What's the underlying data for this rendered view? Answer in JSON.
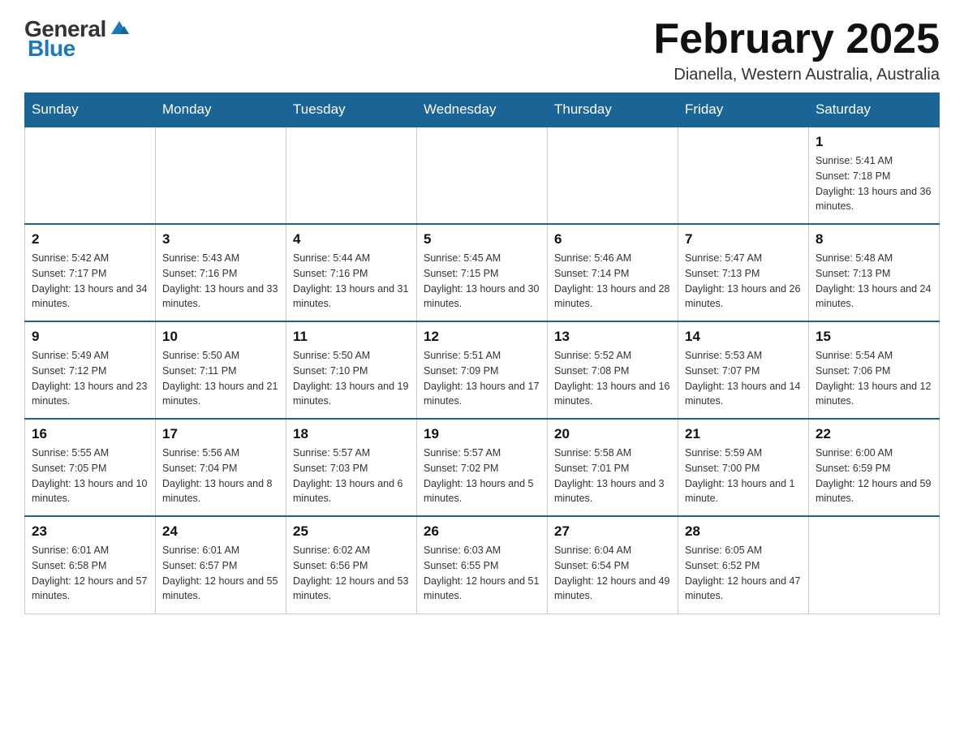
{
  "header": {
    "logo_general": "General",
    "logo_blue": "Blue",
    "title": "February 2025",
    "subtitle": "Dianella, Western Australia, Australia"
  },
  "days_of_week": [
    "Sunday",
    "Monday",
    "Tuesday",
    "Wednesday",
    "Thursday",
    "Friday",
    "Saturday"
  ],
  "weeks": [
    [
      {
        "day": "",
        "sunrise": "",
        "sunset": "",
        "daylight": ""
      },
      {
        "day": "",
        "sunrise": "",
        "sunset": "",
        "daylight": ""
      },
      {
        "day": "",
        "sunrise": "",
        "sunset": "",
        "daylight": ""
      },
      {
        "day": "",
        "sunrise": "",
        "sunset": "",
        "daylight": ""
      },
      {
        "day": "",
        "sunrise": "",
        "sunset": "",
        "daylight": ""
      },
      {
        "day": "",
        "sunrise": "",
        "sunset": "",
        "daylight": ""
      },
      {
        "day": "1",
        "sunrise": "Sunrise: 5:41 AM",
        "sunset": "Sunset: 7:18 PM",
        "daylight": "Daylight: 13 hours and 36 minutes."
      }
    ],
    [
      {
        "day": "2",
        "sunrise": "Sunrise: 5:42 AM",
        "sunset": "Sunset: 7:17 PM",
        "daylight": "Daylight: 13 hours and 34 minutes."
      },
      {
        "day": "3",
        "sunrise": "Sunrise: 5:43 AM",
        "sunset": "Sunset: 7:16 PM",
        "daylight": "Daylight: 13 hours and 33 minutes."
      },
      {
        "day": "4",
        "sunrise": "Sunrise: 5:44 AM",
        "sunset": "Sunset: 7:16 PM",
        "daylight": "Daylight: 13 hours and 31 minutes."
      },
      {
        "day": "5",
        "sunrise": "Sunrise: 5:45 AM",
        "sunset": "Sunset: 7:15 PM",
        "daylight": "Daylight: 13 hours and 30 minutes."
      },
      {
        "day": "6",
        "sunrise": "Sunrise: 5:46 AM",
        "sunset": "Sunset: 7:14 PM",
        "daylight": "Daylight: 13 hours and 28 minutes."
      },
      {
        "day": "7",
        "sunrise": "Sunrise: 5:47 AM",
        "sunset": "Sunset: 7:13 PM",
        "daylight": "Daylight: 13 hours and 26 minutes."
      },
      {
        "day": "8",
        "sunrise": "Sunrise: 5:48 AM",
        "sunset": "Sunset: 7:13 PM",
        "daylight": "Daylight: 13 hours and 24 minutes."
      }
    ],
    [
      {
        "day": "9",
        "sunrise": "Sunrise: 5:49 AM",
        "sunset": "Sunset: 7:12 PM",
        "daylight": "Daylight: 13 hours and 23 minutes."
      },
      {
        "day": "10",
        "sunrise": "Sunrise: 5:50 AM",
        "sunset": "Sunset: 7:11 PM",
        "daylight": "Daylight: 13 hours and 21 minutes."
      },
      {
        "day": "11",
        "sunrise": "Sunrise: 5:50 AM",
        "sunset": "Sunset: 7:10 PM",
        "daylight": "Daylight: 13 hours and 19 minutes."
      },
      {
        "day": "12",
        "sunrise": "Sunrise: 5:51 AM",
        "sunset": "Sunset: 7:09 PM",
        "daylight": "Daylight: 13 hours and 17 minutes."
      },
      {
        "day": "13",
        "sunrise": "Sunrise: 5:52 AM",
        "sunset": "Sunset: 7:08 PM",
        "daylight": "Daylight: 13 hours and 16 minutes."
      },
      {
        "day": "14",
        "sunrise": "Sunrise: 5:53 AM",
        "sunset": "Sunset: 7:07 PM",
        "daylight": "Daylight: 13 hours and 14 minutes."
      },
      {
        "day": "15",
        "sunrise": "Sunrise: 5:54 AM",
        "sunset": "Sunset: 7:06 PM",
        "daylight": "Daylight: 13 hours and 12 minutes."
      }
    ],
    [
      {
        "day": "16",
        "sunrise": "Sunrise: 5:55 AM",
        "sunset": "Sunset: 7:05 PM",
        "daylight": "Daylight: 13 hours and 10 minutes."
      },
      {
        "day": "17",
        "sunrise": "Sunrise: 5:56 AM",
        "sunset": "Sunset: 7:04 PM",
        "daylight": "Daylight: 13 hours and 8 minutes."
      },
      {
        "day": "18",
        "sunrise": "Sunrise: 5:57 AM",
        "sunset": "Sunset: 7:03 PM",
        "daylight": "Daylight: 13 hours and 6 minutes."
      },
      {
        "day": "19",
        "sunrise": "Sunrise: 5:57 AM",
        "sunset": "Sunset: 7:02 PM",
        "daylight": "Daylight: 13 hours and 5 minutes."
      },
      {
        "day": "20",
        "sunrise": "Sunrise: 5:58 AM",
        "sunset": "Sunset: 7:01 PM",
        "daylight": "Daylight: 13 hours and 3 minutes."
      },
      {
        "day": "21",
        "sunrise": "Sunrise: 5:59 AM",
        "sunset": "Sunset: 7:00 PM",
        "daylight": "Daylight: 13 hours and 1 minute."
      },
      {
        "day": "22",
        "sunrise": "Sunrise: 6:00 AM",
        "sunset": "Sunset: 6:59 PM",
        "daylight": "Daylight: 12 hours and 59 minutes."
      }
    ],
    [
      {
        "day": "23",
        "sunrise": "Sunrise: 6:01 AM",
        "sunset": "Sunset: 6:58 PM",
        "daylight": "Daylight: 12 hours and 57 minutes."
      },
      {
        "day": "24",
        "sunrise": "Sunrise: 6:01 AM",
        "sunset": "Sunset: 6:57 PM",
        "daylight": "Daylight: 12 hours and 55 minutes."
      },
      {
        "day": "25",
        "sunrise": "Sunrise: 6:02 AM",
        "sunset": "Sunset: 6:56 PM",
        "daylight": "Daylight: 12 hours and 53 minutes."
      },
      {
        "day": "26",
        "sunrise": "Sunrise: 6:03 AM",
        "sunset": "Sunset: 6:55 PM",
        "daylight": "Daylight: 12 hours and 51 minutes."
      },
      {
        "day": "27",
        "sunrise": "Sunrise: 6:04 AM",
        "sunset": "Sunset: 6:54 PM",
        "daylight": "Daylight: 12 hours and 49 minutes."
      },
      {
        "day": "28",
        "sunrise": "Sunrise: 6:05 AM",
        "sunset": "Sunset: 6:52 PM",
        "daylight": "Daylight: 12 hours and 47 minutes."
      },
      {
        "day": "",
        "sunrise": "",
        "sunset": "",
        "daylight": ""
      }
    ]
  ]
}
